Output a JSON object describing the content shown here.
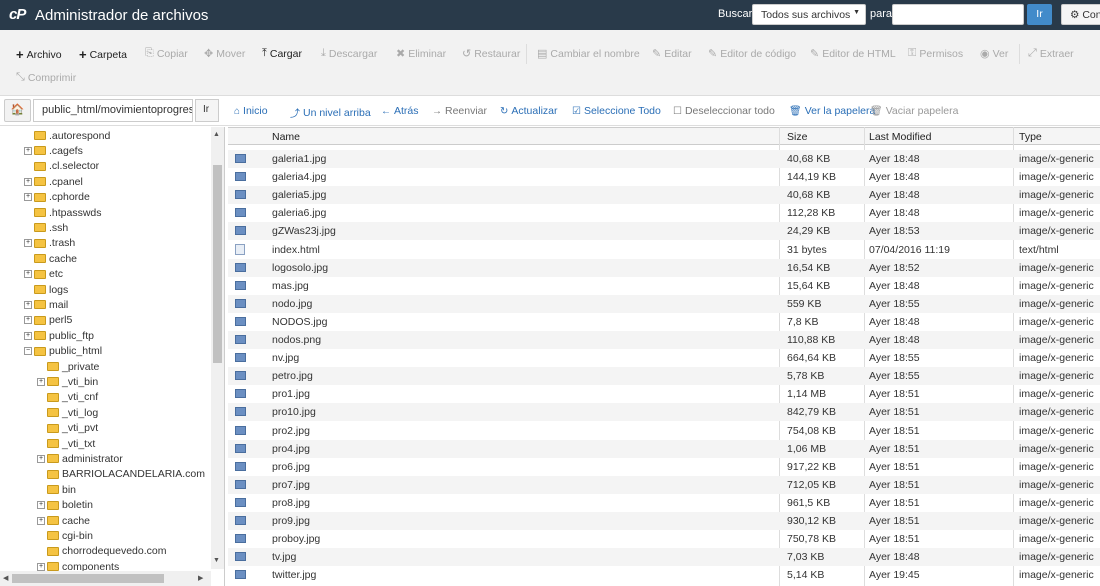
{
  "app": {
    "title": "Administrador de archivos",
    "logo": "cP"
  },
  "search": {
    "label": "Buscar",
    "scope": "Todos sus archivos",
    "for_label": "para",
    "value": "",
    "go": "Ir",
    "settings": "Configuración"
  },
  "toolbar": [
    {
      "label": "Archivo",
      "icon": "+",
      "state": "active"
    },
    {
      "label": "Carpeta",
      "icon": "+",
      "state": "active"
    },
    {
      "label": "Copiar",
      "icon": "⎘",
      "state": "disabled"
    },
    {
      "label": "Mover",
      "icon": "✥",
      "state": "disabled"
    },
    {
      "label": "Cargar",
      "icon": "⤒",
      "state": "active"
    },
    {
      "label": "Descargar",
      "icon": "⤓",
      "state": "disabled"
    },
    {
      "label": "Eliminar",
      "icon": "✖",
      "state": "disabled"
    },
    {
      "label": "Restaurar",
      "icon": "↺",
      "state": "disabled"
    },
    {
      "label": "Cambiar el nombre",
      "icon": "▤",
      "state": "disabled"
    },
    {
      "label": "Editar",
      "icon": "✎",
      "state": "disabled"
    },
    {
      "label": "Editor de código",
      "icon": "✎",
      "state": "disabled"
    },
    {
      "label": "Editor de HTML",
      "icon": "✎",
      "state": "disabled"
    },
    {
      "label": "Permisos",
      "icon": "⚿",
      "state": "disabled"
    },
    {
      "label": "Ver",
      "icon": "◉",
      "state": "disabled"
    },
    {
      "label": "Extraer",
      "icon": "⤢",
      "state": "disabled"
    },
    {
      "label": "Comprimir",
      "icon": "⤡",
      "state": "disabled"
    }
  ],
  "path": {
    "value": "public_html/movimientoprogresis",
    "go": "Ir"
  },
  "nav": [
    {
      "label": "Inicio",
      "icon": "⌂",
      "style": "blue"
    },
    {
      "label": "Un nivel arriba",
      "icon": "⤴",
      "style": "blue"
    },
    {
      "label": "Atrás",
      "icon": "←",
      "style": "blue"
    },
    {
      "label": "Reenviar",
      "icon": "→",
      "style": "grey"
    },
    {
      "label": "Actualizar",
      "icon": "↻",
      "style": "blue"
    },
    {
      "label": "Seleccione Todo",
      "icon": "☑",
      "style": "blue"
    },
    {
      "label": "Deseleccionar todo",
      "icon": "☐",
      "style": "grey"
    },
    {
      "label": "Ver la papelera",
      "icon": "🗑",
      "style": "blue"
    },
    {
      "label": "Vaciar papelera",
      "icon": "🗑",
      "style": "lgrey"
    }
  ],
  "tree": [
    {
      "label": ".autorespond",
      "expand": false,
      "depth": 0
    },
    {
      "label": ".cagefs",
      "expand": true,
      "depth": 0
    },
    {
      "label": ".cl.selector",
      "expand": false,
      "depth": 0
    },
    {
      "label": ".cpanel",
      "expand": true,
      "depth": 0
    },
    {
      "label": ".cphorde",
      "expand": true,
      "depth": 0
    },
    {
      "label": ".htpasswds",
      "expand": false,
      "depth": 0
    },
    {
      "label": ".ssh",
      "expand": false,
      "depth": 0
    },
    {
      "label": ".trash",
      "expand": true,
      "depth": 0
    },
    {
      "label": "cache",
      "expand": false,
      "depth": 0
    },
    {
      "label": "etc",
      "expand": true,
      "depth": 0
    },
    {
      "label": "logs",
      "expand": false,
      "depth": 0
    },
    {
      "label": "mail",
      "expand": true,
      "depth": 0
    },
    {
      "label": "perl5",
      "expand": true,
      "depth": 0
    },
    {
      "label": "public_ftp",
      "expand": true,
      "depth": 0
    },
    {
      "label": "public_html",
      "expand": "open",
      "depth": 0
    },
    {
      "label": "_private",
      "expand": false,
      "depth": 1
    },
    {
      "label": "_vti_bin",
      "expand": true,
      "depth": 1
    },
    {
      "label": "_vti_cnf",
      "expand": false,
      "depth": 1
    },
    {
      "label": "_vti_log",
      "expand": false,
      "depth": 1
    },
    {
      "label": "_vti_pvt",
      "expand": false,
      "depth": 1
    },
    {
      "label": "_vti_txt",
      "expand": false,
      "depth": 1
    },
    {
      "label": "administrator",
      "expand": true,
      "depth": 1
    },
    {
      "label": "BARRIOLACANDELARIA.com",
      "expand": false,
      "depth": 1
    },
    {
      "label": "bin",
      "expand": false,
      "depth": 1
    },
    {
      "label": "boletin",
      "expand": true,
      "depth": 1
    },
    {
      "label": "cache",
      "expand": true,
      "depth": 1
    },
    {
      "label": "cgi-bin",
      "expand": false,
      "depth": 1
    },
    {
      "label": "chorrodequevedo.com",
      "expand": false,
      "depth": 1
    },
    {
      "label": "components",
      "expand": true,
      "depth": 1
    }
  ],
  "table": {
    "headers": {
      "name": "Name",
      "size": "Size",
      "modified": "Last Modified",
      "type": "Type"
    },
    "rows": [
      {
        "name": "galeria1.jpg",
        "size": "40,68 KB",
        "modified": "Ayer 18:48",
        "type": "image/x-generic",
        "kind": "image"
      },
      {
        "name": "galeria4.jpg",
        "size": "144,19 KB",
        "modified": "Ayer 18:48",
        "type": "image/x-generic",
        "kind": "image"
      },
      {
        "name": "galeria5.jpg",
        "size": "40,68 KB",
        "modified": "Ayer 18:48",
        "type": "image/x-generic",
        "kind": "image"
      },
      {
        "name": "galeria6.jpg",
        "size": "112,28 KB",
        "modified": "Ayer 18:48",
        "type": "image/x-generic",
        "kind": "image"
      },
      {
        "name": "gZWas23j.jpg",
        "size": "24,29 KB",
        "modified": "Ayer 18:53",
        "type": "image/x-generic",
        "kind": "image"
      },
      {
        "name": "index.html",
        "size": "31 bytes",
        "modified": "07/04/2016 11:19",
        "type": "text/html",
        "kind": "html"
      },
      {
        "name": "logosolo.jpg",
        "size": "16,54 KB",
        "modified": "Ayer 18:52",
        "type": "image/x-generic",
        "kind": "image"
      },
      {
        "name": "mas.jpg",
        "size": "15,64 KB",
        "modified": "Ayer 18:48",
        "type": "image/x-generic",
        "kind": "image"
      },
      {
        "name": "nodo.jpg",
        "size": "559 KB",
        "modified": "Ayer 18:55",
        "type": "image/x-generic",
        "kind": "image"
      },
      {
        "name": "NODOS.jpg",
        "size": "7,8 KB",
        "modified": "Ayer 18:48",
        "type": "image/x-generic",
        "kind": "image"
      },
      {
        "name": "nodos.png",
        "size": "110,88 KB",
        "modified": "Ayer 18:48",
        "type": "image/x-generic",
        "kind": "image"
      },
      {
        "name": "nv.jpg",
        "size": "664,64 KB",
        "modified": "Ayer 18:55",
        "type": "image/x-generic",
        "kind": "image"
      },
      {
        "name": "petro.jpg",
        "size": "5,78 KB",
        "modified": "Ayer 18:55",
        "type": "image/x-generic",
        "kind": "image"
      },
      {
        "name": "pro1.jpg",
        "size": "1,14 MB",
        "modified": "Ayer 18:51",
        "type": "image/x-generic",
        "kind": "image"
      },
      {
        "name": "pro10.jpg",
        "size": "842,79 KB",
        "modified": "Ayer 18:51",
        "type": "image/x-generic",
        "kind": "image"
      },
      {
        "name": "pro2.jpg",
        "size": "754,08 KB",
        "modified": "Ayer 18:51",
        "type": "image/x-generic",
        "kind": "image"
      },
      {
        "name": "pro4.jpg",
        "size": "1,06 MB",
        "modified": "Ayer 18:51",
        "type": "image/x-generic",
        "kind": "image"
      },
      {
        "name": "pro6.jpg",
        "size": "917,22 KB",
        "modified": "Ayer 18:51",
        "type": "image/x-generic",
        "kind": "image"
      },
      {
        "name": "pro7.jpg",
        "size": "712,05 KB",
        "modified": "Ayer 18:51",
        "type": "image/x-generic",
        "kind": "image"
      },
      {
        "name": "pro8.jpg",
        "size": "961,5 KB",
        "modified": "Ayer 18:51",
        "type": "image/x-generic",
        "kind": "image"
      },
      {
        "name": "pro9.jpg",
        "size": "930,12 KB",
        "modified": "Ayer 18:51",
        "type": "image/x-generic",
        "kind": "image"
      },
      {
        "name": "proboy.jpg",
        "size": "750,78 KB",
        "modified": "Ayer 18:51",
        "type": "image/x-generic",
        "kind": "image"
      },
      {
        "name": "tv.jpg",
        "size": "7,03 KB",
        "modified": "Ayer 18:48",
        "type": "image/x-generic",
        "kind": "image"
      },
      {
        "name": "twitter.jpg",
        "size": "5,14 KB",
        "modified": "Ayer 19:45",
        "type": "image/x-generic",
        "kind": "image"
      }
    ]
  },
  "colors": {
    "topbar": "#293a4a",
    "accent": "#428bca",
    "link": "#2a6eb6",
    "folder": "#f5c342"
  }
}
